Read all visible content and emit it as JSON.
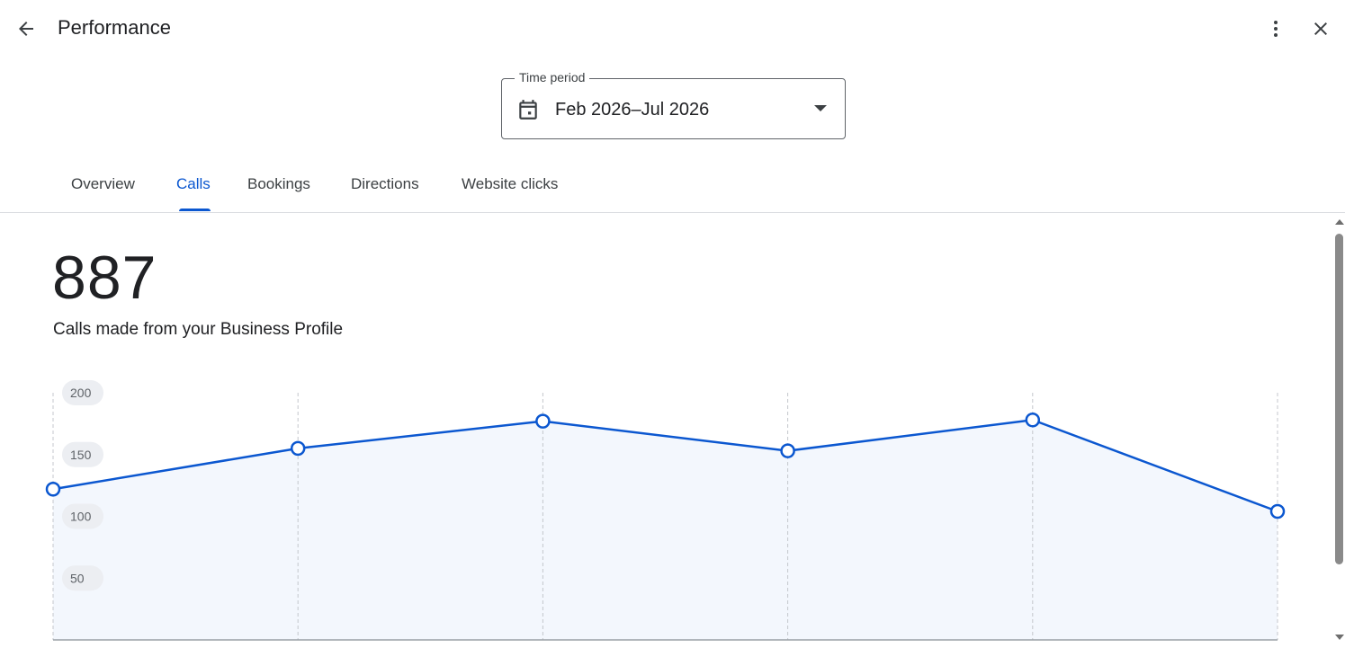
{
  "header": {
    "title": "Performance",
    "back_icon": "arrow-back-icon",
    "more_icon": "more-vert-icon",
    "close_icon": "close-icon"
  },
  "time_period": {
    "label": "Time period",
    "value": "Feb 2026–Jul 2026",
    "icon": "calendar-icon"
  },
  "tabs": [
    {
      "label": "Overview",
      "active": false
    },
    {
      "label": "Calls",
      "active": true
    },
    {
      "label": "Bookings",
      "active": false
    },
    {
      "label": "Directions",
      "active": false
    },
    {
      "label": "Website clicks",
      "active": false
    }
  ],
  "summary": {
    "total": "887",
    "description": "Calls made from your Business Profile"
  },
  "colors": {
    "accent": "#0b57d0",
    "area_fill": "#f3f7fd",
    "grid": "#c4c7cc"
  },
  "chart_data": {
    "type": "area",
    "title": "",
    "xlabel": "",
    "ylabel": "",
    "ylim": [
      0,
      200
    ],
    "y_ticks": [
      200,
      150,
      100,
      50
    ],
    "x_count": 6,
    "values": [
      122,
      155,
      177,
      153,
      178,
      104
    ]
  }
}
